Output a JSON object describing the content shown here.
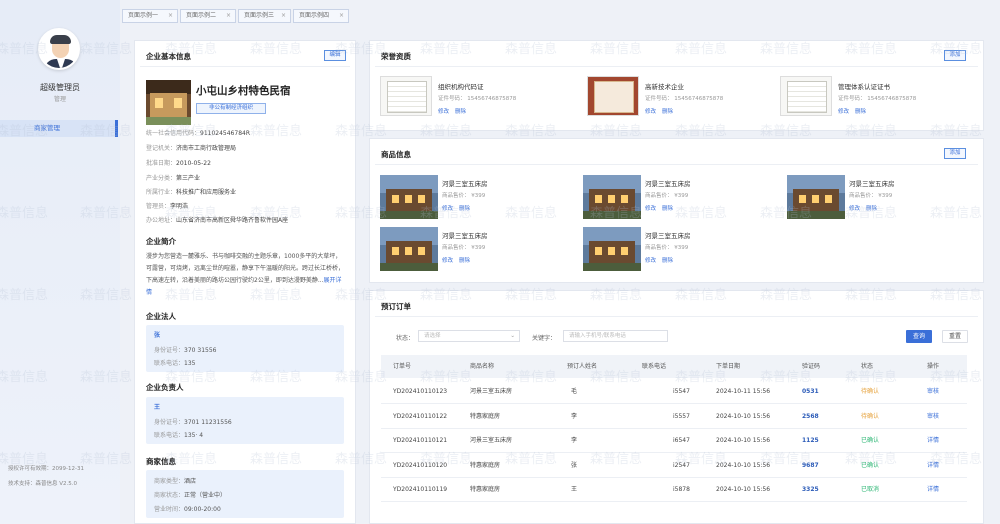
{
  "sidebar": {
    "user_name": "超级管理员",
    "user_role": "管理",
    "nav_items": [
      {
        "label": "商家管理",
        "active": true
      }
    ],
    "footer": [
      "授权许可有效期：2099-12-31",
      "技术支持：森普信息 V2.5.0"
    ]
  },
  "tabs": [
    {
      "label": "页面示例一"
    },
    {
      "label": "页面示例二"
    },
    {
      "label": "页面示例三"
    },
    {
      "label": "页面示例四"
    }
  ],
  "business": {
    "section_title": "企业基本信息",
    "edit_label": "编辑",
    "name": "小屯山乡村特色民宿",
    "tag": "非公有制经济组织",
    "fields": [
      {
        "label": "统一社会信用代码：",
        "value": "91102454678​4R"
      },
      {
        "label": "登记机关：",
        "value": "济南市工商行政管理局"
      },
      {
        "label": "批准日期：",
        "value": "2010-05-22"
      },
      {
        "label": "产业分类：",
        "value": "第三产业"
      },
      {
        "label": "所属行业：",
        "value": "科技推广和应用服务业"
      },
      {
        "label": "管理员：",
        "value": "李明浩"
      },
      {
        "label": "办公地址：",
        "value": "山东省济南市高新区舜华路齐鲁软件园A座"
      }
    ],
    "intro_title": "企业简介",
    "intro_text": "漫步为您营造一麓雅乐、书与咖啡交融的主题乐章，1000多平的大草坪，可露营，可烧烤，远离尘世的喧嚣，静享下午温暖的阳光。跨过长江桥桥，下高速左转，沿着美丽的路坊公园行驶约2公里，即到达漫野美静...",
    "intro_more": "展开详情",
    "legal_title": "企业法人",
    "legal": {
      "name": "张",
      "id_label": "身份证号：",
      "id_value": "370          31556",
      "phone_label": "联系电话：",
      "phone_value": "135"
    },
    "manager_title": "企业负责人",
    "manager": {
      "name": "王",
      "id_label": "身份证号：",
      "id_value": "3701          11231556",
      "phone_label": "联系电话：",
      "phone_value": "135·          4"
    },
    "merchant_title": "商家信息",
    "merchant": [
      {
        "label": "商家类型：",
        "value": "酒店"
      },
      {
        "label": "商家状态：",
        "value": "正常（营业中）"
      },
      {
        "label": "营业时间：",
        "value": "09:00-20:00"
      }
    ]
  },
  "honors": {
    "section_title": "荣誉资质",
    "add_label": "添加",
    "items": [
      {
        "name": "组织机构代码证",
        "no": "证件号码： 15456746875878",
        "edit": "修改",
        "delete": "删除"
      },
      {
        "name": "高新技术企业",
        "no": "证件号码： 15456746875878",
        "edit": "修改",
        "delete": "删除"
      },
      {
        "name": "管理体系认证证书",
        "no": "证件号码： 15456746875878",
        "edit": "修改",
        "delete": "删除"
      }
    ]
  },
  "products": {
    "section_title": "商品信息",
    "add_label": "添加",
    "items": [
      {
        "name": "河景三室五床房",
        "price": "商品售价： ¥399",
        "edit": "修改",
        "delete": "删除"
      },
      {
        "name": "河景三室五床房",
        "price": "商品售价： ¥399",
        "edit": "修改",
        "delete": "删除"
      },
      {
        "name": "河景三室五床房",
        "price": "商品售价： ¥399",
        "edit": "修改",
        "delete": "删除"
      },
      {
        "name": "河景三室五床房",
        "price": "商品售价： ¥399",
        "edit": "修改",
        "delete": "删除"
      },
      {
        "name": "河景三室五床房",
        "price": "商品售价： ¥399",
        "edit": "修改",
        "delete": "删除"
      }
    ]
  },
  "orders": {
    "section_title": "预订订单",
    "status_label": "状态：",
    "status_placeholder": "请选择",
    "keyword_label": "关键字：",
    "keyword_placeholder": "请输入手机号/联系电话",
    "search_label": "查询",
    "reset_label": "重置",
    "columns": [
      "订单号",
      "商品名称",
      "预订人姓名",
      "联系电话",
      "下单日期",
      "验证码",
      "状态",
      "操作"
    ],
    "rows": [
      {
        "order_no": "YD202410110123",
        "product": "河景三室五床房",
        "guest": "毛",
        "phone": "i5547",
        "date": "2024-10-11  15:56",
        "code": "0531",
        "status": "待确认",
        "status_color": "#e6a23c",
        "action": "审核"
      },
      {
        "order_no": "YD202410110122",
        "product": "特惠家庭房",
        "guest": "李",
        "phone": "i5557",
        "date": "2024-10-10  15:56",
        "code": "2568",
        "status": "待确认",
        "status_color": "#e6a23c",
        "action": "审核"
      },
      {
        "order_no": "YD202410110121",
        "product": "河景三室五床房",
        "guest": "李",
        "phone": "i6547",
        "date": "2024-10-10  15:56",
        "code": "1125",
        "status": "已确认",
        "status_color": "#2bb673",
        "action": "详情"
      },
      {
        "order_no": "YD202410110120",
        "product": "特惠家庭房",
        "guest": "张",
        "phone": "i2547",
        "date": "2024-10-10  15:56",
        "code": "9687",
        "status": "已确认",
        "status_color": "#2bb673",
        "action": "详情"
      },
      {
        "order_no": "YD202410110119",
        "product": "特惠家庭房",
        "guest": "王",
        "phone": "i5878",
        "date": "2024-10-10  15:56",
        "code": "3325",
        "status": "已取消",
        "status_color": "#2bb673",
        "action": "详情"
      }
    ]
  },
  "watermark_text": "森普信息"
}
